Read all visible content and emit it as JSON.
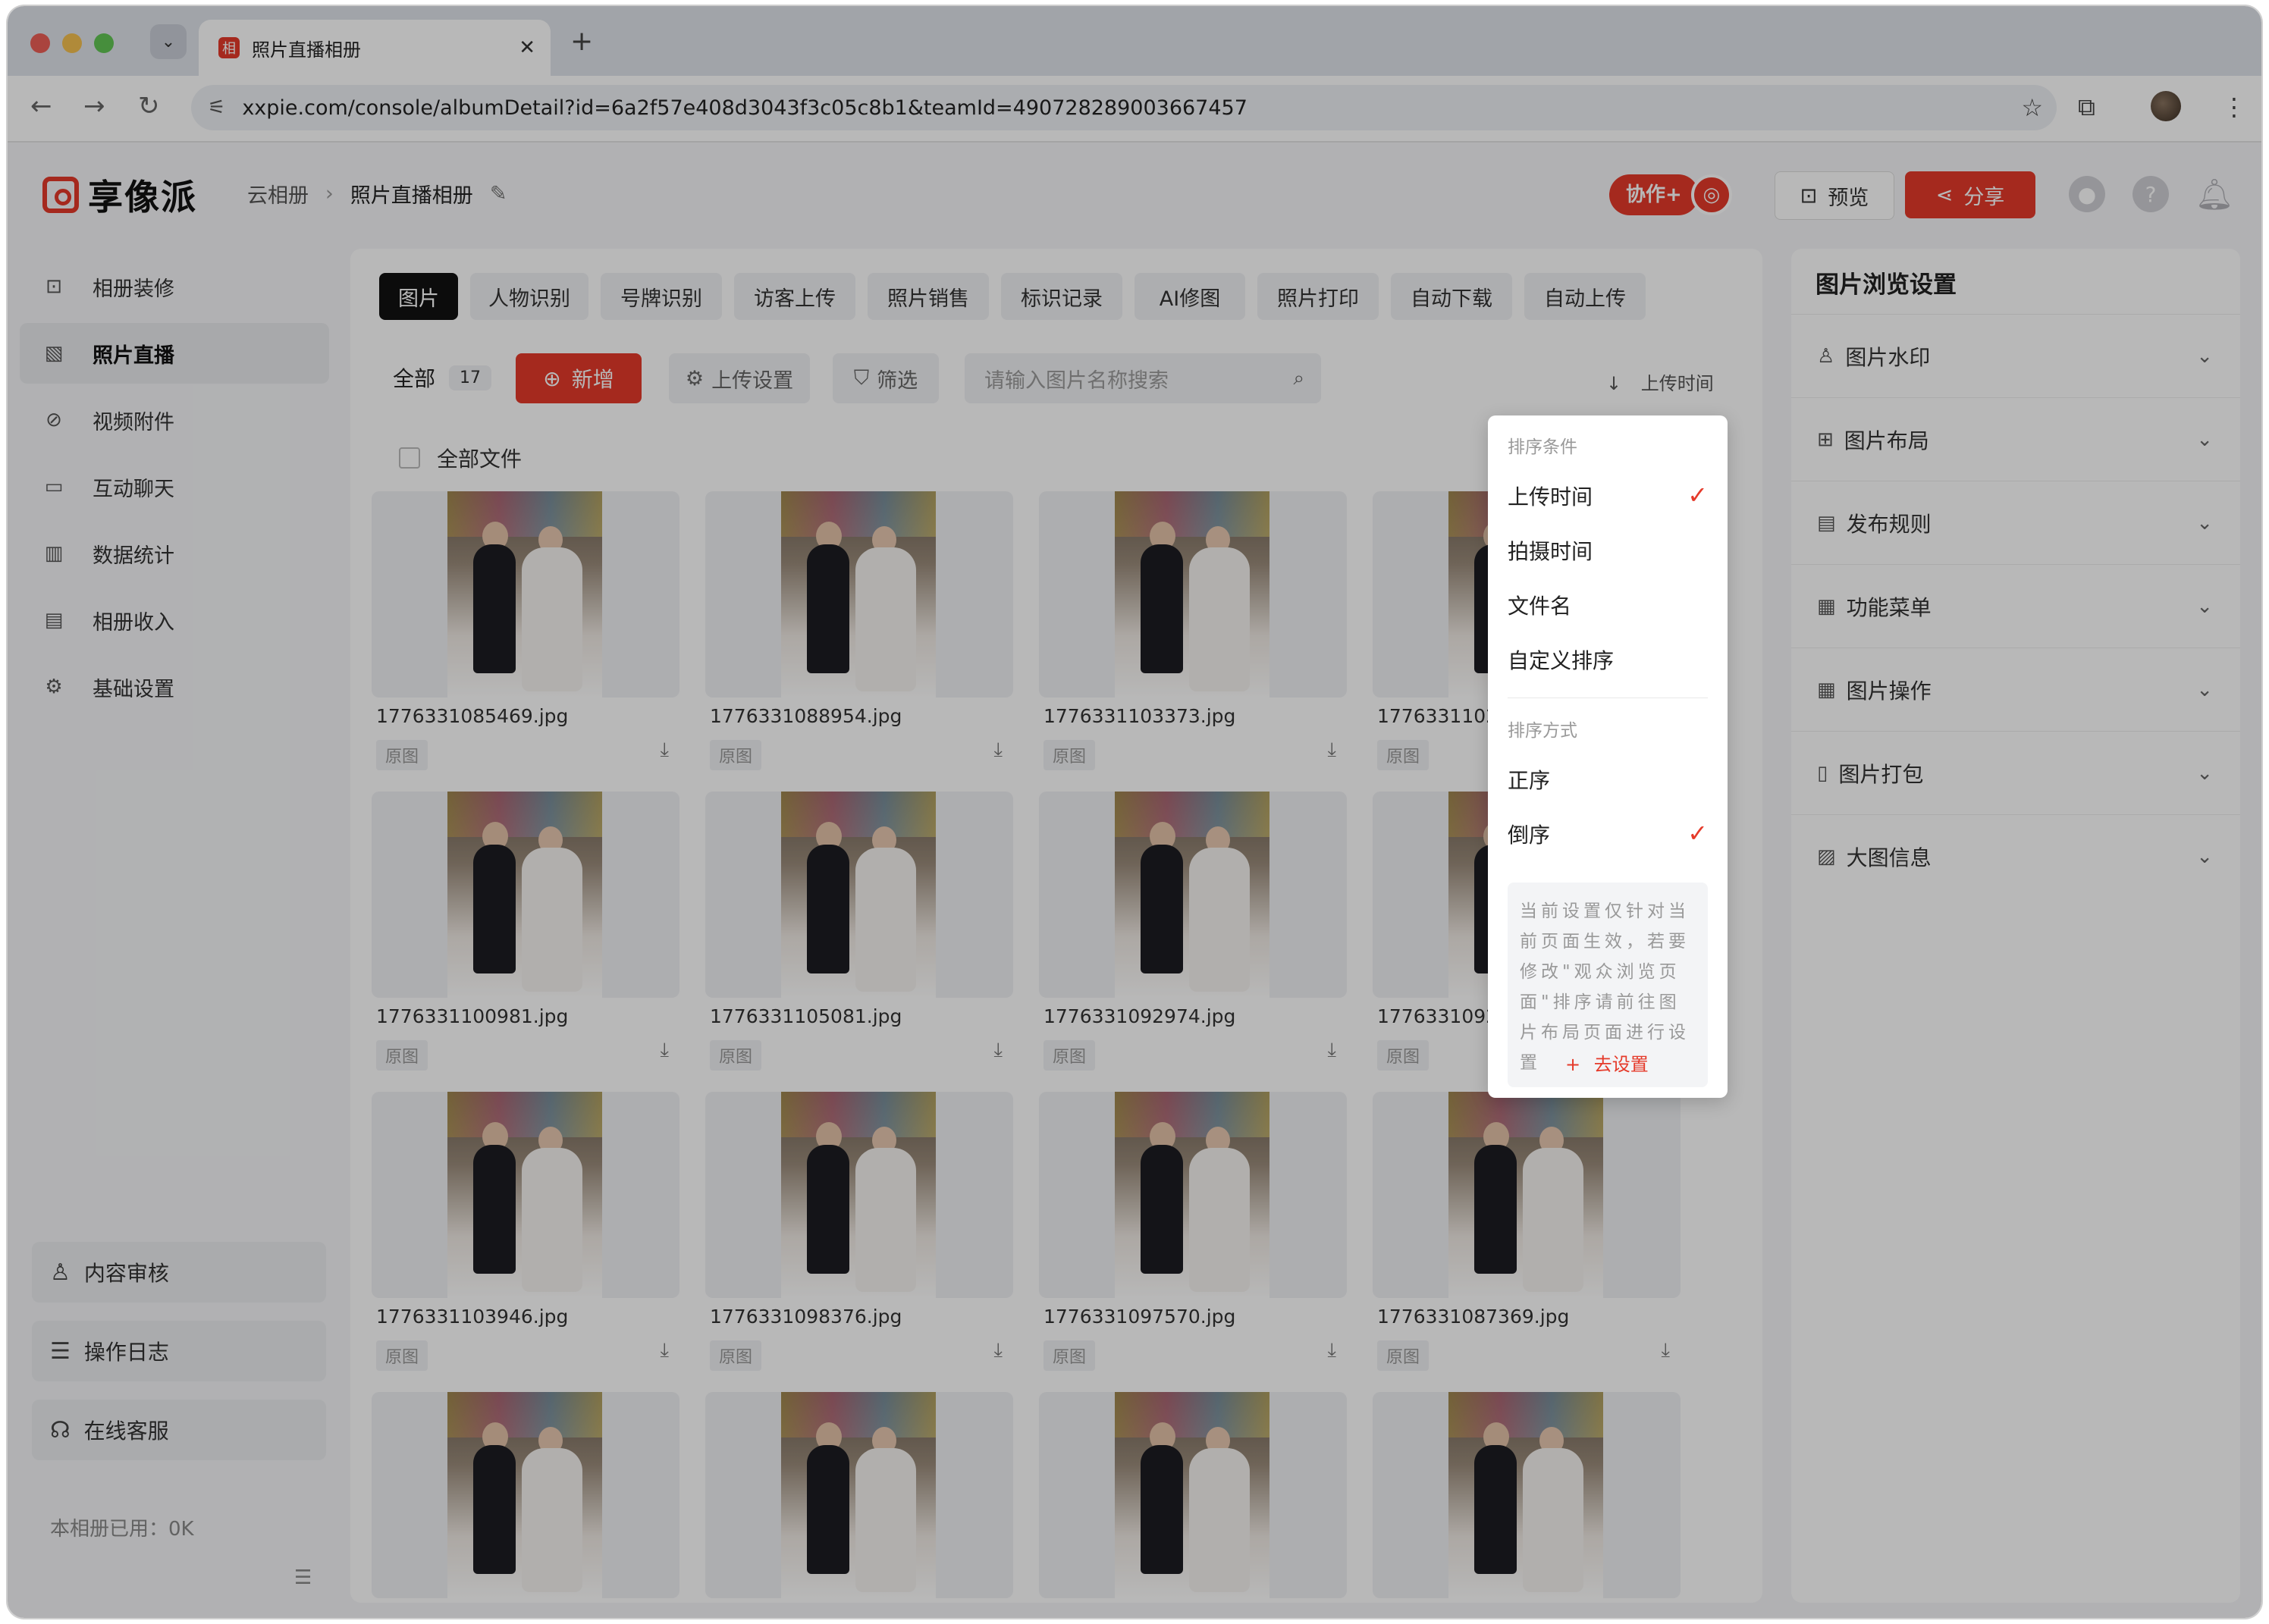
{
  "browser": {
    "tab_title": "照片直播相册",
    "tab_favicon": "相",
    "url": "xxpie.com/console/albumDetail?id=6a2f57e408d3043f3c05c8b1&teamId=490728289003667457"
  },
  "header": {
    "logo_text": "享像派",
    "breadcrumb": [
      "云相册",
      "照片直播相册"
    ],
    "collab_label": "协作+",
    "preview_label": "预览",
    "share_label": "分享"
  },
  "sidebar": {
    "items": [
      {
        "label": "相册装修",
        "icon": "decorate-icon",
        "glyph": "⊡"
      },
      {
        "label": "照片直播",
        "icon": "image-icon",
        "glyph": "▧"
      },
      {
        "label": "视频附件",
        "icon": "paperclip-icon",
        "glyph": "⊘"
      },
      {
        "label": "互动聊天",
        "icon": "chat-icon",
        "glyph": "▭"
      },
      {
        "label": "数据统计",
        "icon": "stats-icon",
        "glyph": "▥"
      },
      {
        "label": "相册收入",
        "icon": "wallet-icon",
        "glyph": "▤"
      },
      {
        "label": "基础设置",
        "icon": "gear-icon",
        "glyph": "⚙"
      }
    ],
    "bottom": [
      {
        "label": "内容审核",
        "icon": "user-review-icon",
        "glyph": "♙"
      },
      {
        "label": "操作日志",
        "icon": "log-icon",
        "glyph": "☰"
      },
      {
        "label": "在线客服",
        "icon": "headset-icon",
        "glyph": "☊"
      }
    ],
    "usage": "本相册已用：0K"
  },
  "tabs": [
    "图片",
    "人物识别",
    "号牌识别",
    "访客上传",
    "照片销售",
    "标识记录",
    "AI修图",
    "照片打印",
    "自动下载",
    "自动上传"
  ],
  "toolbar": {
    "all_label": "全部",
    "count": "17",
    "add_label": "新增",
    "upload_settings": "上传设置",
    "filter": "筛选",
    "search_placeholder": "请输入图片名称搜索",
    "sort_label": "上传时间",
    "all_files": "全部文件"
  },
  "photos": [
    {
      "name": "1776331085469.jpg",
      "tag": "原图"
    },
    {
      "name": "1776331088954.jpg",
      "tag": "原图"
    },
    {
      "name": "1776331103373.jpg",
      "tag": "原图"
    },
    {
      "name": "1776331102",
      "tag": "原图"
    },
    {
      "name": "1776331100981.jpg",
      "tag": "原图"
    },
    {
      "name": "1776331105081.jpg",
      "tag": "原图"
    },
    {
      "name": "1776331092974.jpg",
      "tag": "原图"
    },
    {
      "name": "1776331092",
      "tag": "原图"
    },
    {
      "name": "1776331103946.jpg",
      "tag": "原图"
    },
    {
      "name": "1776331098376.jpg",
      "tag": "原图"
    },
    {
      "name": "1776331097570.jpg",
      "tag": "原图"
    },
    {
      "name": "1776331087369.jpg",
      "tag": "原图"
    },
    {
      "name": "",
      "tag": ""
    },
    {
      "name": "",
      "tag": ""
    },
    {
      "name": "",
      "tag": ""
    },
    {
      "name": "",
      "tag": ""
    }
  ],
  "sort_dropdown": {
    "condition_header": "排序条件",
    "conditions": [
      {
        "label": "上传时间",
        "checked": true
      },
      {
        "label": "拍摄时间",
        "checked": false
      },
      {
        "label": "文件名",
        "checked": false
      },
      {
        "label": "自定义排序",
        "checked": false
      }
    ],
    "order_header": "排序方式",
    "orders": [
      {
        "label": "正序",
        "checked": false
      },
      {
        "label": "倒序",
        "checked": true
      }
    ],
    "note": "当前设置仅针对当前页面生效，若要修改\"观众浏览页面\"排序请前往图片布局页面进行设置",
    "go_label": "去设置"
  },
  "right_panel": {
    "title": "图片浏览设置",
    "items": [
      {
        "label": "图片水印",
        "icon": "watermark-icon",
        "glyph": "♙"
      },
      {
        "label": "图片布局",
        "icon": "layout-icon",
        "glyph": "⊞"
      },
      {
        "label": "发布规则",
        "icon": "rule-icon",
        "glyph": "▤"
      },
      {
        "label": "功能菜单",
        "icon": "menu-icon",
        "glyph": "▦"
      },
      {
        "label": "图片操作",
        "icon": "operation-icon",
        "glyph": "▦"
      },
      {
        "label": "图片打包",
        "icon": "package-icon",
        "glyph": "▯"
      },
      {
        "label": "大图信息",
        "icon": "big-image-icon",
        "glyph": "▨"
      }
    ]
  },
  "colors": {
    "accent": "#e53a2a",
    "active_tab": "#111111",
    "app_bg": "#f5f6f8"
  }
}
